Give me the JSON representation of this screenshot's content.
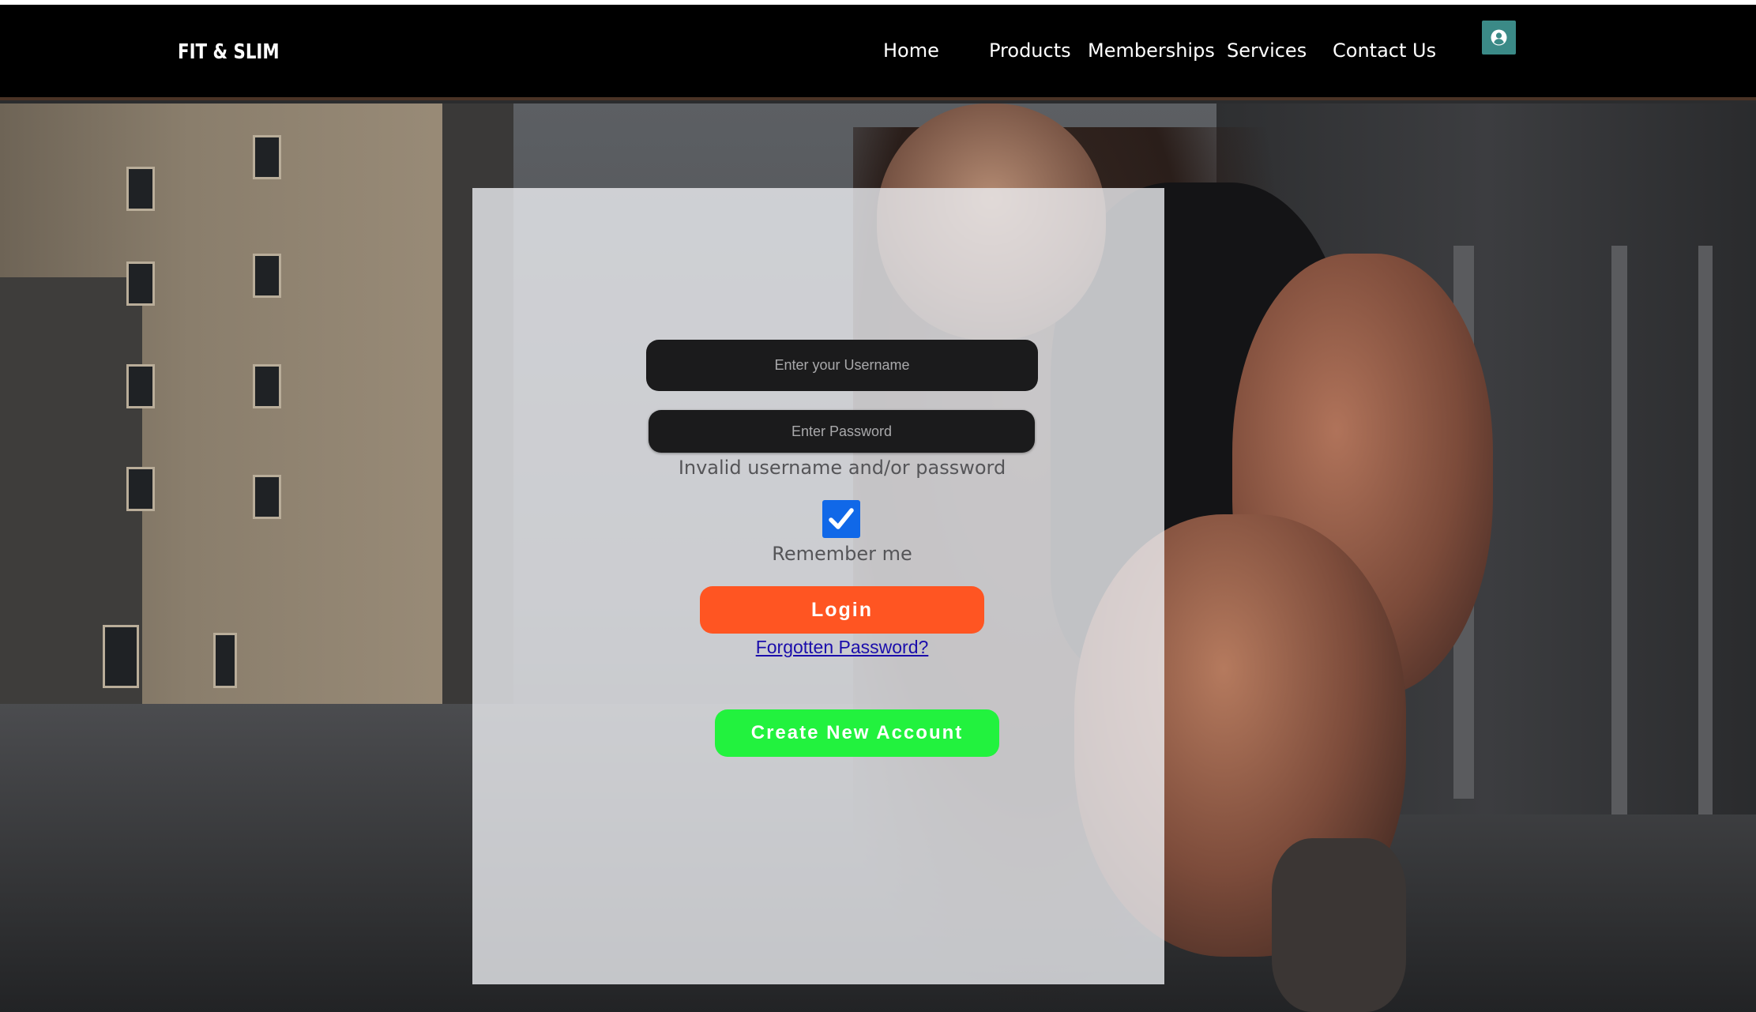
{
  "header": {
    "logo": "FIT & SLIM",
    "nav": {
      "home": "Home",
      "products": "Products",
      "memberships": "Memberships",
      "services": "Services",
      "contact": "Contact Us"
    },
    "user_icon": "user-avatar-icon"
  },
  "login": {
    "username_placeholder": "Enter your Username",
    "username_value": "",
    "password_placeholder": "Enter Password",
    "password_value": "",
    "error_message": "Invalid username and/or password",
    "remember_checked": true,
    "remember_label": "Remember me",
    "login_label": "Login",
    "forgot_label": "Forgotten Password?",
    "create_label": "Create New Account"
  },
  "colors": {
    "header_bg": "#000000",
    "user_button": "#3b8a87",
    "login_button": "#ff5522",
    "create_button": "#22f23e",
    "checkbox": "#1068e8",
    "link": "#1a0dab"
  }
}
